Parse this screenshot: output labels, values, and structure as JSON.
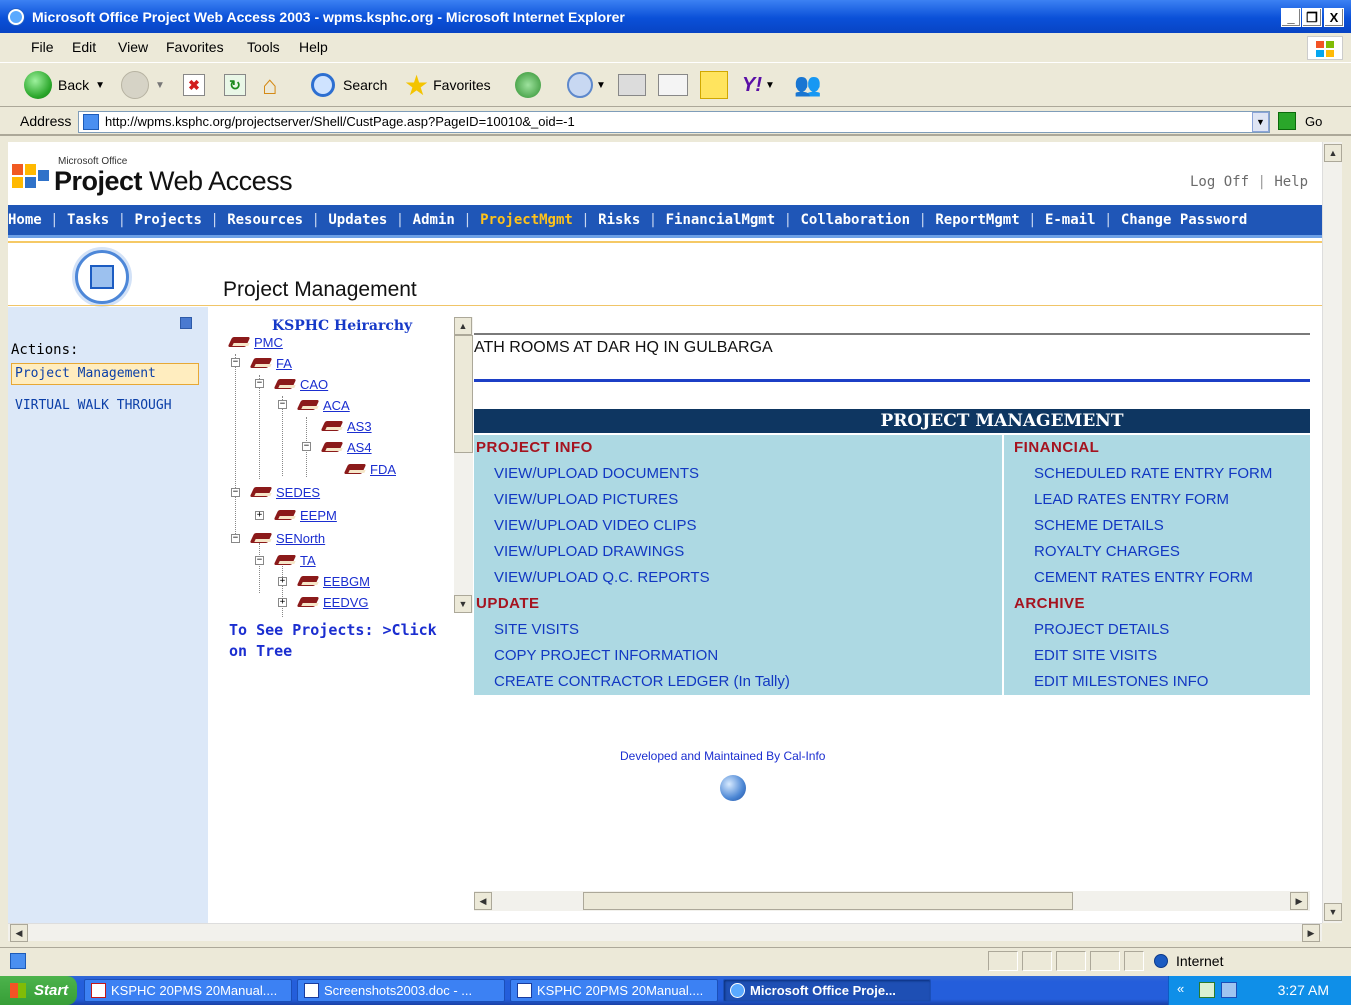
{
  "window": {
    "title": "Microsoft Office Project Web Access 2003 - wpms.ksphc.org - Microsoft Internet Explorer",
    "minimize": "_",
    "restore": "❐",
    "close": "X"
  },
  "menu": [
    "File",
    "Edit",
    "View",
    "Favorites",
    "Tools",
    "Help"
  ],
  "toolbar": {
    "back": "Back",
    "search": "Search",
    "favorites": "Favorites"
  },
  "address": {
    "label": "Address",
    "url": "http://wpms.ksphc.org/projectserver/Shell/CustPage.asp?PageID=10010&_oid=-1",
    "go": "Go"
  },
  "pwa": {
    "ms_office": "Microsoft Office",
    "title_bold": "Project",
    "title_rest": " Web Access",
    "logoff": "Log Off",
    "help": "Help",
    "nav": [
      "Home",
      "Tasks",
      "Projects",
      "Resources",
      "Updates",
      "Admin",
      "ProjectMgmt",
      "Risks",
      "FinancialMgmt",
      "Collaboration",
      "ReportMgmt",
      "E-mail",
      "Change Password"
    ],
    "active_nav": "ProjectMgmt",
    "page_title": "Project Management"
  },
  "actions": {
    "label": "Actions:",
    "items": [
      "Project Management",
      "VIRTUAL WALK THROUGH"
    ]
  },
  "tree": {
    "title": "KSPHC Heirarchy",
    "nodes": [
      "PMC",
      "FA",
      "CAO",
      "ACA",
      "AS3",
      "AS4",
      "FDA",
      "SEDES",
      "EEPM",
      "SENorth",
      "TA",
      "EEBGM",
      "EEDVG"
    ],
    "hint": "To See Projects: >Click on Tree"
  },
  "content": {
    "project_name": "ATH ROOMS AT DAR HQ IN GULBARGA",
    "table_title": "PROJECT MANAGEMENT",
    "sections": {
      "project_info": "PROJECT INFO",
      "financial": "FINANCIAL",
      "update": "UPDATE",
      "archive": "ARCHIVE"
    },
    "project_info_links": [
      "VIEW/UPLOAD DOCUMENTS",
      "VIEW/UPLOAD PICTURES",
      "VIEW/UPLOAD VIDEO CLIPS",
      "VIEW/UPLOAD DRAWINGS",
      "VIEW/UPLOAD Q.C. REPORTS"
    ],
    "financial_links": [
      "SCHEDULED RATE ENTRY FORM",
      "LEAD RATES ENTRY FORM",
      "SCHEME DETAILS",
      "ROYALTY CHARGES",
      "CEMENT RATES ENTRY FORM"
    ],
    "update_links": [
      "SITE VISITS",
      "COPY PROJECT INFORMATION",
      "CREATE CONTRACTOR LEDGER (In Tally)"
    ],
    "archive_links": [
      "PROJECT DETAILS",
      "EDIT SITE VISITS",
      "EDIT MILESTONES INFO"
    ],
    "footer": "Developed and Maintained By Cal-Info"
  },
  "status": {
    "zone": "Internet"
  },
  "taskbar": {
    "start": "Start",
    "tasks": [
      "KSPHC 20PMS 20Manual....",
      "Screenshots2003.doc - ...",
      "KSPHC 20PMS 20Manual....",
      "Microsoft Office Proje..."
    ],
    "clock": "3:27 AM",
    "chevron": "«"
  }
}
